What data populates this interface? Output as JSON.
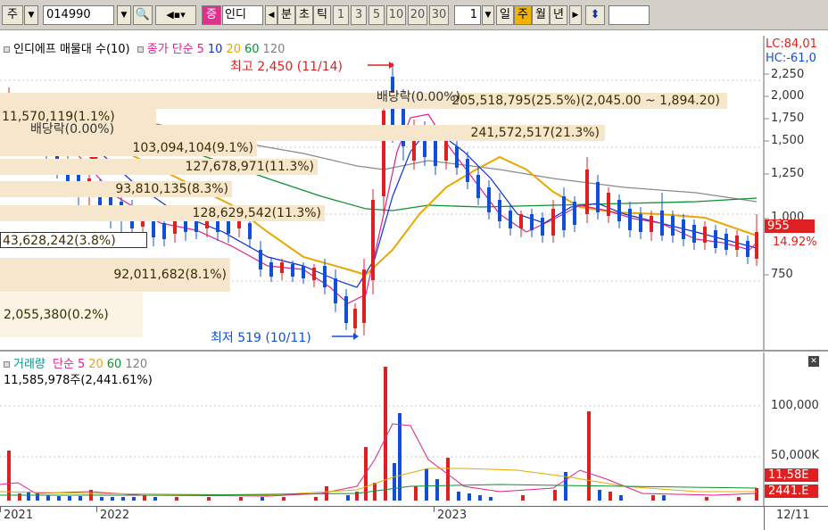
{
  "toolbar": {
    "market": "주",
    "code": "014990",
    "tag": "증",
    "name": "인디",
    "tabs": [
      "분",
      "초",
      "틱",
      "1",
      "3",
      "5",
      "10",
      "20",
      "30"
    ],
    "period_value": "1",
    "periods": [
      "일",
      "주",
      "월",
      "년"
    ]
  },
  "price_pane": {
    "legend_title": "인디에프 매물대 수(10)",
    "legend_price": "종가",
    "legend_ma_label": "단순",
    "ma": [
      {
        "period": "5",
        "color": "#e0208c"
      },
      {
        "period": "10",
        "color": "#1030d0"
      },
      {
        "period": "20",
        "color": "#e8a800"
      },
      {
        "period": "60",
        "color": "#109030"
      },
      {
        "period": "120",
        "color": "#808080"
      }
    ],
    "lc": "LC:84,01",
    "hc": "HC:-61,0",
    "high_label": "최고 2,450 (11/14)",
    "low_label": "최저 519 (10/11)",
    "dividend_labels": [
      "배당락(0.00%)",
      "배당락(0.00%)"
    ],
    "price_axis": [
      "2,250",
      "2,000",
      "1,750",
      "1,500",
      "1,250",
      "1,000",
      "750"
    ],
    "current_price": "955",
    "change_pct": "14.92%",
    "volume_profile": [
      "11,570,119(1.1%)",
      "205,518,795(25.5%)(2,045.00 ~ 1,894.20)",
      "241,572,517(21.3%)",
      "103,094,104(9.1%)",
      "127,678,971(11.3%)",
      "93,810,135(8.3%)",
      "128,629,542(11.3%)",
      "43,628,242(3.8%)",
      "92,011,682(8.1%)",
      "2,055,380(0.2%)"
    ]
  },
  "volume_pane": {
    "legend_title": "거래량",
    "legend_ma_label": "단순",
    "ma": [
      {
        "period": "5",
        "color": "#e0208c"
      },
      {
        "period": "20",
        "color": "#e8a800"
      },
      {
        "period": "60",
        "color": "#109030"
      },
      {
        "period": "120",
        "color": "#808080"
      }
    ],
    "current_volume": "11,585,978주(2,441.61%)",
    "axis": [
      "100,000",
      "50,000K"
    ],
    "badge_volume": "11,58E",
    "badge_pct": "2441.E"
  },
  "time_axis": {
    "labels": [
      "2021",
      "2022",
      "2023"
    ],
    "last_date": "12/11"
  },
  "colors": {
    "up": "#e02020",
    "down": "#1050d8",
    "profile": "#f5e6cc"
  }
}
